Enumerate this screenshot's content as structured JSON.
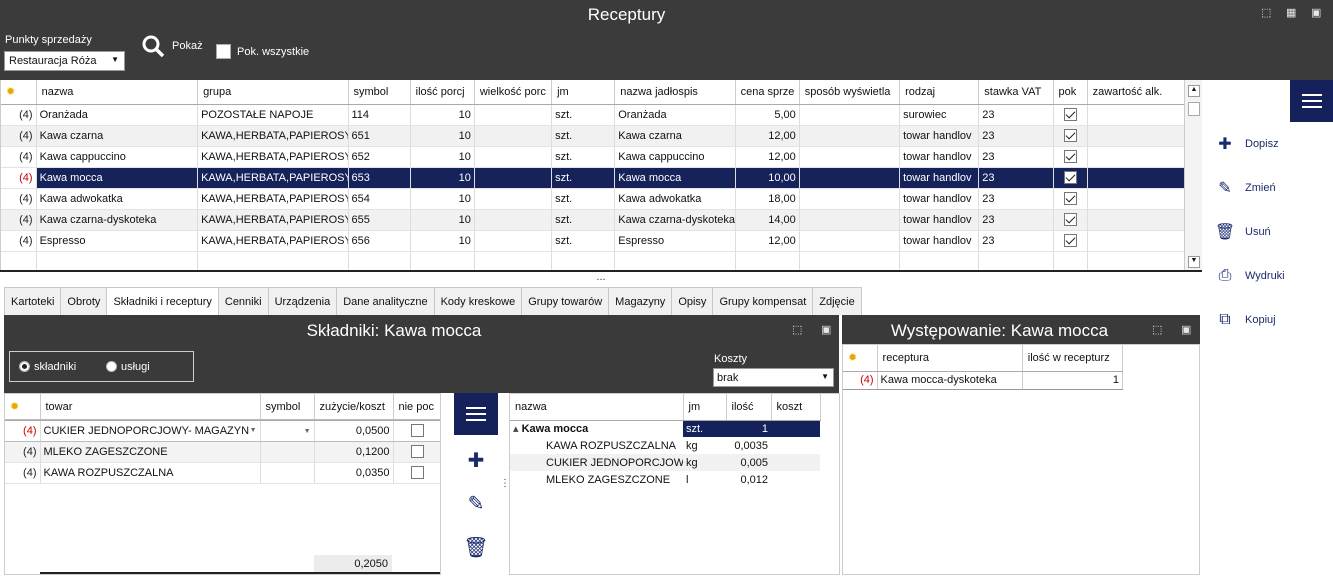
{
  "app": {
    "title": "Receptury"
  },
  "filter": {
    "pos_label": "Punkty sprzedaży",
    "pos_value": "Restauracja Róża",
    "show_label": "Pokaż",
    "show_all_label": "Pok. wszystkie",
    "show_all_checked": false
  },
  "grid": {
    "columns": [
      "nazwa",
      "grupa",
      "symbol",
      "ilość porcj",
      "wielkość porc",
      "jm",
      "nazwa jadłospis",
      "cena sprze",
      "sposób wyświetla",
      "rodzaj",
      "stawka VAT",
      "pok",
      "zawartość alk."
    ],
    "rows": [
      {
        "n": "(4)",
        "nazwa": "Oranżada",
        "grupa": "POZOSTAŁE NAPOJE",
        "symbol": "114",
        "ilosc": "10",
        "wielkosc": "",
        "jm": "szt.",
        "jadlospis": "Oranżada",
        "cena": "5,00",
        "sposob": "",
        "rodzaj": "surowiec",
        "vat": "23",
        "pok": true,
        "alk": ""
      },
      {
        "n": "(4)",
        "nazwa": "Kawa czarna",
        "grupa": "KAWA,HERBATA,PAPIEROSY",
        "symbol": "651",
        "ilosc": "10",
        "wielkosc": "",
        "jm": "szt.",
        "jadlospis": "Kawa czarna",
        "cena": "12,00",
        "sposob": "",
        "rodzaj": "towar handlov",
        "vat": "23",
        "pok": true,
        "alk": ""
      },
      {
        "n": "(4)",
        "nazwa": "Kawa cappuccino",
        "grupa": "KAWA,HERBATA,PAPIEROSY",
        "symbol": "652",
        "ilosc": "10",
        "wielkosc": "",
        "jm": "szt.",
        "jadlospis": "Kawa cappuccino",
        "cena": "12,00",
        "sposob": "",
        "rodzaj": "towar handlov",
        "vat": "23",
        "pok": true,
        "alk": ""
      },
      {
        "n": "(4)",
        "nazwa": "Kawa mocca",
        "grupa": "KAWA,HERBATA,PAPIEROSY",
        "symbol": "653",
        "ilosc": "10",
        "wielkosc": "",
        "jm": "szt.",
        "jadlospis": "Kawa mocca",
        "cena": "10,00",
        "sposob": "",
        "rodzaj": "towar handlov",
        "vat": "23",
        "pok": true,
        "alk": ""
      },
      {
        "n": "(4)",
        "nazwa": "Kawa adwokatka",
        "grupa": "KAWA,HERBATA,PAPIEROSY",
        "symbol": "654",
        "ilosc": "10",
        "wielkosc": "",
        "jm": "szt.",
        "jadlospis": "Kawa adwokatka",
        "cena": "18,00",
        "sposob": "",
        "rodzaj": "towar handlov",
        "vat": "23",
        "pok": true,
        "alk": ""
      },
      {
        "n": "(4)",
        "nazwa": "Kawa czarna-dyskoteka",
        "grupa": "KAWA,HERBATA,PAPIEROSY",
        "symbol": "655",
        "ilosc": "10",
        "wielkosc": "",
        "jm": "szt.",
        "jadlospis": "Kawa czarna-dyskoteka",
        "cena": "14,00",
        "sposob": "",
        "rodzaj": "towar handlov",
        "vat": "23",
        "pok": true,
        "alk": ""
      },
      {
        "n": "(4)",
        "nazwa": "Espresso",
        "grupa": "KAWA,HERBATA,PAPIEROSY",
        "symbol": "656",
        "ilosc": "10",
        "wielkosc": "",
        "jm": "szt.",
        "jadlospis": "Espresso",
        "cena": "12,00",
        "sposob": "",
        "rodzaj": "towar handlov",
        "vat": "23",
        "pok": true,
        "alk": ""
      }
    ],
    "selected_row": 3
  },
  "splitter": "...",
  "actions": [
    "Dopisz",
    "Zmień",
    "Usuń",
    "Wydruki",
    "Kopiuj"
  ],
  "tabs": [
    "Kartoteki",
    "Obroty",
    "Składniki i receptury",
    "Cenniki",
    "Urządzenia",
    "Dane analityczne",
    "Kody kreskowe",
    "Grupy towarów",
    "Magazyny",
    "Opisy",
    "Grupy kompensat",
    "Zdjęcie"
  ],
  "active_tab": 2,
  "skladniki": {
    "title": "Składniki: Kawa mocca",
    "radio1": "składniki",
    "radio2": "usługi",
    "koszty_label": "Koszty",
    "koszty_value": "brak",
    "columns": [
      "towar",
      "symbol",
      "zużycie/koszt",
      "nie poc"
    ],
    "rows": [
      {
        "n": "(4)",
        "towar": "CUKIER JEDNOPORCJOWY- MAGAZYN",
        "symbol": "",
        "zuzycie": "0,0500"
      },
      {
        "n": "(4)",
        "towar": "MLEKO ZAGESZCZONE",
        "symbol": "",
        "zuzycie": "0,1200"
      },
      {
        "n": "(4)",
        "towar": "KAWA ROZPUSZCZALNA",
        "symbol": "",
        "zuzycie": "0,0350"
      }
    ],
    "total": "0,2050"
  },
  "tree": {
    "columns": [
      "nazwa",
      "jm",
      "ilość",
      "koszt"
    ],
    "rows": [
      {
        "nazwa": "Kawa mocca",
        "jm": "szt.",
        "ilosc": "1",
        "koszt": ""
      },
      {
        "nazwa": "KAWA ROZPUSZCZALNA",
        "jm": "kg",
        "ilosc": "0,0035",
        "koszt": ""
      },
      {
        "nazwa": "CUKIER JEDNOPORCJOWY",
        "jm": "kg",
        "ilosc": "0,005",
        "koszt": ""
      },
      {
        "nazwa": "MLEKO ZAGESZCZONE",
        "jm": "l",
        "ilosc": "0,012",
        "koszt": ""
      }
    ]
  },
  "wystepowanie": {
    "title": "Występowanie: Kawa mocca",
    "columns": [
      "receptura",
      "ilość w recepturz"
    ],
    "rows": [
      {
        "n": "(4)",
        "receptura": "Kawa mocca-dyskoteka",
        "ilosc": "1"
      }
    ]
  }
}
